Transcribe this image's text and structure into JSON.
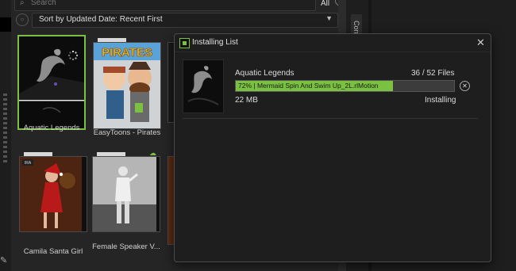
{
  "library": {
    "search_placeholder": "Search",
    "all_label": "All",
    "sort_label": "Sort by Updated Date: Recent First",
    "cards": [
      {
        "label": "Aquatic Legends"
      },
      {
        "label": "EasyToons - Pirates",
        "thumb_text": "PIRATES"
      },
      {
        "label": "Camila Santa Girl",
        "badge": "IRA"
      },
      {
        "label": "Female Speaker V..."
      }
    ]
  },
  "side_tab": {
    "label": "Cont"
  },
  "dialog": {
    "title": "Installing List",
    "item": {
      "name": "Aquatic Legends",
      "files": "36 / 52 Files",
      "progress_text": "72%  | Mermaid Spin And Swim Up_2L.rlMotion",
      "progress": 0.72,
      "size": "22 MB",
      "status": "Installing"
    }
  },
  "colors": {
    "accent": "#7ac142"
  },
  "icons": [
    "search-icon",
    "filter-icon",
    "chevron-down-icon",
    "close-icon",
    "cancel-icon",
    "cloud-download-icon",
    "loading-spinner-icon",
    "edit-icon"
  ]
}
